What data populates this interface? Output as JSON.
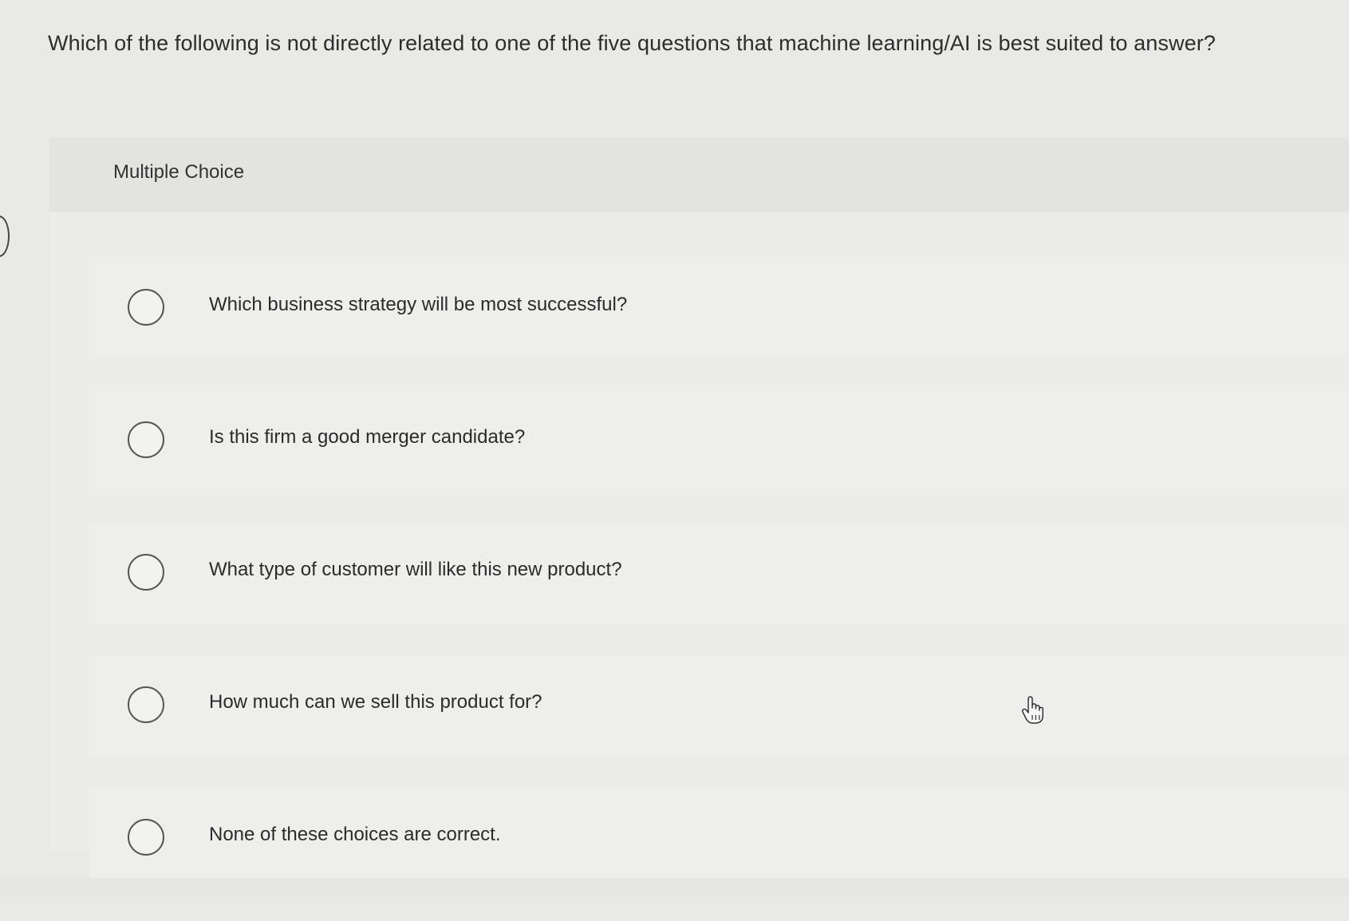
{
  "question": {
    "text": "Which of the following is not directly related to one of the five questions that machine learning/AI is best suited to answer?"
  },
  "panel": {
    "type_label": "Multiple Choice"
  },
  "choices": [
    {
      "label": "Which business strategy will be most successful?"
    },
    {
      "label": "Is this firm a good merger candidate?"
    },
    {
      "label": "What type of customer will like this new product?"
    },
    {
      "label": "How much can we sell this product for?"
    },
    {
      "label": "None of these choices are correct."
    }
  ],
  "icons": {
    "radio": "radio-empty-icon",
    "cursor": "hand-pointer-icon"
  }
}
